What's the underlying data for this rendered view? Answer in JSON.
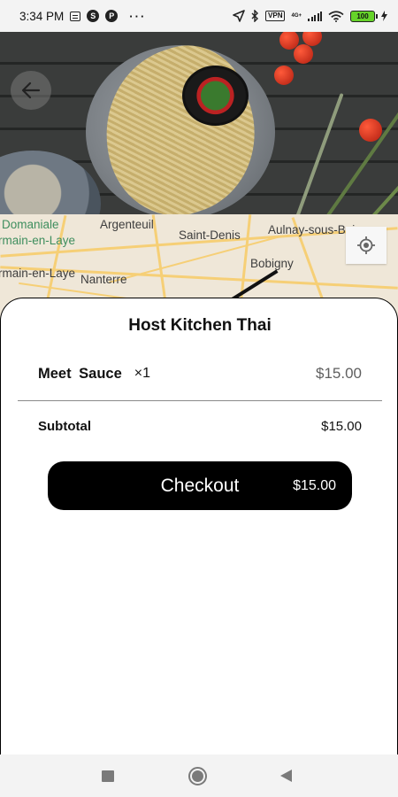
{
  "status_bar": {
    "time": "3:34 PM",
    "left_icons": [
      "notes-icon",
      "s-app-icon",
      "p-app-icon"
    ],
    "more": "···",
    "vpn": "VPN",
    "network": "4G+",
    "battery": "100"
  },
  "hero": {
    "image": "food-photo",
    "back_icon": "arrow-left-icon"
  },
  "map": {
    "labels": [
      {
        "text": "Domaniale",
        "green": true
      },
      {
        "text": "rmain-en-Laye",
        "green": true
      },
      {
        "text": "Argenteuil",
        "green": false
      },
      {
        "text": "Saint-Denis",
        "green": false
      },
      {
        "text": "Aulnay-sous-Bois",
        "green": false
      },
      {
        "text": "Bobigny",
        "green": false
      },
      {
        "text": "rmain-en-Laye",
        "green": false
      },
      {
        "text": "Nanterre",
        "green": false
      }
    ],
    "locate_icon": "my-location-icon"
  },
  "cart": {
    "restaurant_name": "Host Kitchen Thai",
    "items": [
      {
        "name": "Meet  Sauce",
        "qty": "×1",
        "price": "$15.00"
      }
    ],
    "subtotal_label": "Subtotal",
    "subtotal_value": "$15.00",
    "checkout_label": "Checkout",
    "checkout_amount": "$15.00"
  },
  "nav_bar": {
    "icons": [
      "recents-square-icon",
      "home-circle-icon",
      "back-triangle-icon"
    ]
  },
  "colors": {
    "button_bg": "#000000",
    "sheet_bg": "#ffffff",
    "battery_fill": "#66d32a",
    "road": "#f6cf76",
    "map_bg": "#efe7d8"
  }
}
